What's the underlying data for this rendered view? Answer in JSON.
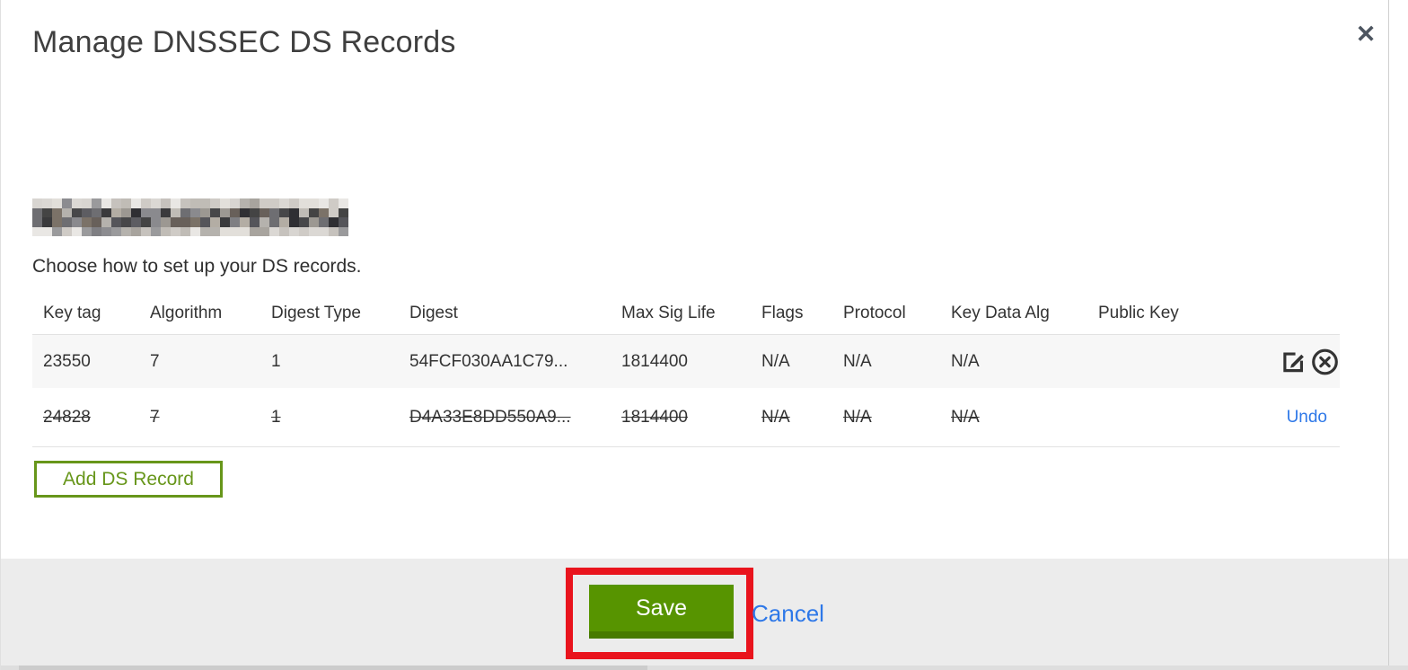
{
  "dialog": {
    "title": "Manage DNSSEC DS Records",
    "close_glyph": "✕",
    "instruction": "Choose how to set up your DS records."
  },
  "table": {
    "headers": [
      "Key tag",
      "Algorithm",
      "Digest Type",
      "Digest",
      "Max Sig Life",
      "Flags",
      "Protocol",
      "Key Data Alg",
      "Public Key"
    ],
    "rows": [
      {
        "key_tag": "23550",
        "algorithm": "7",
        "digest_type": "1",
        "digest": "54FCF030AA1C79...",
        "max_sig_life": "1814400",
        "flags": "N/A",
        "protocol": "N/A",
        "key_data_alg": "N/A",
        "public_key": "",
        "state": "active"
      },
      {
        "key_tag": "24828",
        "algorithm": "7",
        "digest_type": "1",
        "digest": "D4A33E8DD550A9...",
        "max_sig_life": "1814400",
        "flags": "N/A",
        "protocol": "N/A",
        "key_data_alg": "N/A",
        "public_key": "",
        "state": "deleted",
        "undo_label": "Undo"
      }
    ]
  },
  "actions": {
    "add_ds_record": "Add DS Record",
    "save": "Save",
    "cancel": "Cancel"
  },
  "icons": {
    "edit": "edit-icon",
    "delete": "delete-icon",
    "close": "close-icon"
  },
  "colors": {
    "save_green": "#579400",
    "save_green_dark": "#477a00",
    "add_outline_green": "#67961a",
    "link_blue": "#2e78e8",
    "annotation_red": "#e9141d",
    "footer_gray": "#ececec",
    "row_stripe_gray": "#f7f7f7"
  }
}
